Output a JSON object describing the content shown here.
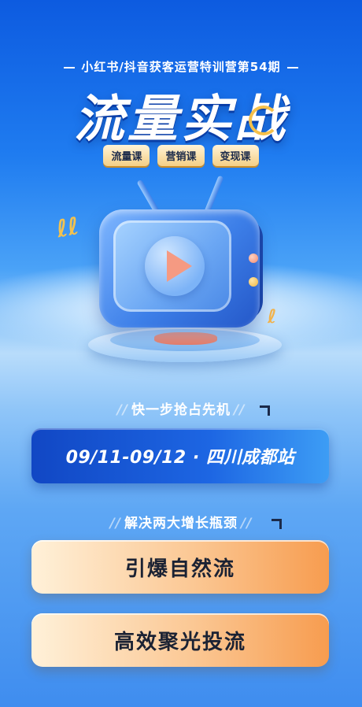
{
  "header": {
    "subtitle": "小红书/抖音获客运营特训营第54期",
    "title": "流量实战",
    "tags": [
      "流量课",
      "营销课",
      "变现课"
    ]
  },
  "section1": {
    "heading": "快一步抢占先机",
    "marks": "//",
    "date_venue": "09/11-09/12 · 四川成都站"
  },
  "section2": {
    "heading": "解决两大增长瓶颈",
    "marks": "//",
    "items": [
      "引爆自然流",
      "高效聚光投流"
    ]
  },
  "colors": {
    "primary_blue": "#1d66e3",
    "accent_gold": "#f4cf86",
    "accent_orange": "#f79c4f",
    "play_coral": "#f59a82"
  },
  "icons": [
    "tv-icon",
    "play-icon",
    "squiggle-icon"
  ]
}
